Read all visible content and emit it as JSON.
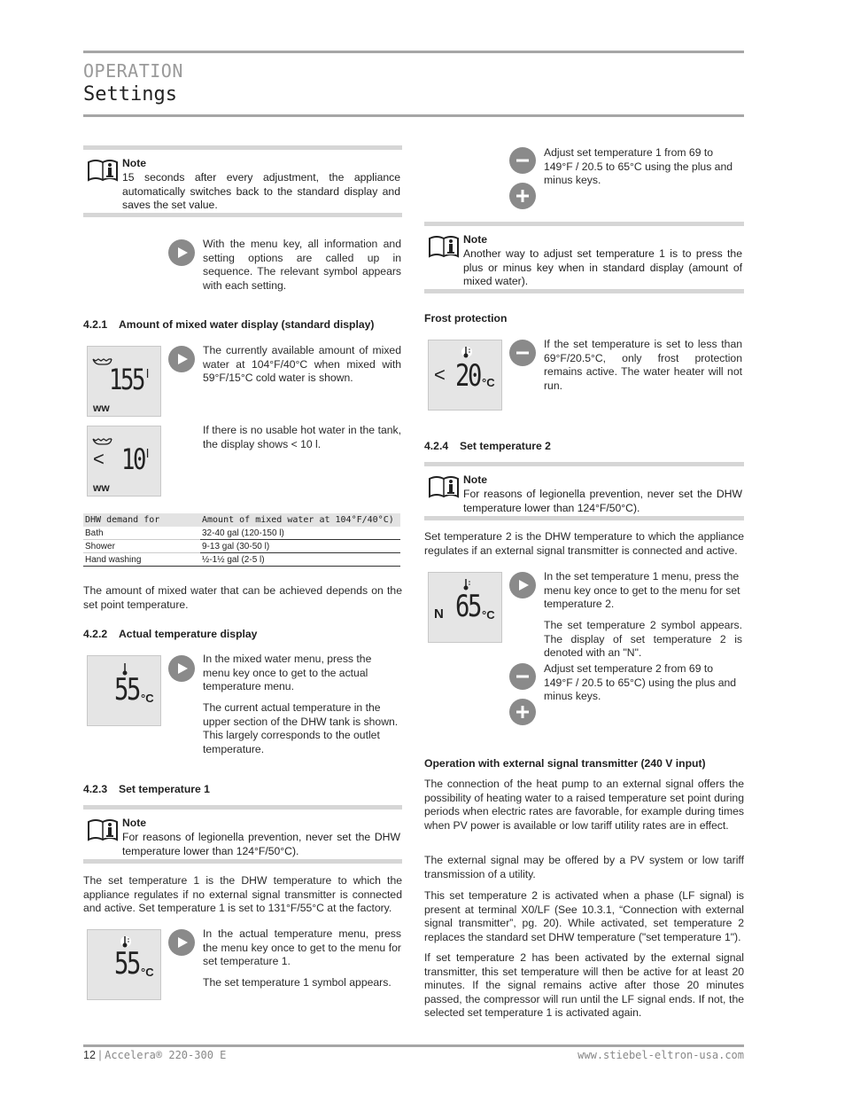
{
  "header": {
    "section": "OPERATION",
    "title": "Settings"
  },
  "left": {
    "note1": {
      "title": "Note",
      "text": "15 seconds after every adjustment, the appliance automatically switches back to the standard display and saves the set value."
    },
    "menu_key_text": "With the menu key, all information and setting options are called up in sequence. The relevant symbol appears with each setting.",
    "s421": {
      "num": "4.2.1",
      "title": "Amount of mixed water display (standard display)"
    },
    "lcd155": {
      "value": "155",
      "unit": "l",
      "label": "ww"
    },
    "text155": "The currently available amount of mixed water at 104°F/40°C when mixed with 59°F/15°C cold water is shown.",
    "lcd10": {
      "prefix": "<",
      "value": "10",
      "unit": "l",
      "label": "ww"
    },
    "text10": "If there is no usable hot water in the tank, the display shows < 10 l.",
    "table": {
      "headers": [
        "DHW demand for",
        "Amount of mixed water at 104°F/40°C)"
      ],
      "rows": [
        [
          "Bath",
          "32-40 gal (120-150 l)"
        ],
        [
          "Shower",
          "9-13 gal (30-50 l)"
        ],
        [
          "Hand washing",
          "½-1½ gal (2-5 l)"
        ]
      ]
    },
    "mixed_note": "The amount of mixed water that can be achieved depends on the set point temperature.",
    "s422": {
      "num": "4.2.2",
      "title": "Actual temperature display"
    },
    "lcd55a": {
      "value": "55",
      "unit": "°C"
    },
    "actual_text1": "In the mixed water menu, press the menu key once to get to the actual temperature menu.",
    "actual_text2": "The current actual temperature in the upper section of the DHW tank is shown. This largely corresponds to the outlet temperature.",
    "s423": {
      "num": "4.2.3",
      "title": "Set temperature 1"
    },
    "note2": {
      "title": "Note",
      "text": "For reasons of legionella prevention, never set the DHW temperature lower than 124°F/50°C)."
    },
    "set1_text": "The set temperature 1 is the DHW temperature to which the appliance regulates if no external signal transmitter is connected and active. Set temperature 1 is set to 131°F/55°C at the factory.",
    "lcd55b": {
      "value": "55",
      "unit": "°C"
    },
    "set1_menu_text": "In the actual temperature menu, press the menu key once to get to the menu for set temperature 1.",
    "set1_symbol_text": "The set temperature 1 symbol appears."
  },
  "right": {
    "adjust1_text": "Adjust set temperature 1 from 69 to 149°F / 20.5 to 65°C using the plus and minus keys.",
    "note3": {
      "title": "Note",
      "text": "Another way to adjust set temperature 1 is to press the plus or minus key when in standard display (amount of mixed water)."
    },
    "frost_heading": "Frost protection",
    "lcd20": {
      "prefix": "<",
      "value": "20",
      "unit": "°C"
    },
    "frost_text": "If the set temperature is set to less than 69°F/20.5°C, only frost protection remains active. The water heater will not run.",
    "s424": {
      "num": "4.2.4",
      "title": "Set temperature 2"
    },
    "note4": {
      "title": "Note",
      "text": "For reasons of legionella prevention, never set the DHW temperature lower than 124°F/50°C)."
    },
    "set2_text": "Set temperature 2 is the DHW temperature to which the appliance regulates if an external signal transmitter is connected and active.",
    "lcd65": {
      "prefix": "N",
      "value": "65",
      "unit": "°C"
    },
    "set2_menu_text": "In the set temperature 1 menu, press the menu key once to get to the menu for set temperature 2.",
    "set2_symbol_text": "The set temperature 2 symbol appears. The display of set temperature 2 is denoted with an \"N\".",
    "adjust2_text": "Adjust set temperature 2 from 69 to 149°F / 20.5 to 65°C) using the plus and minus keys.",
    "ext_heading": "Operation with external signal transmitter (240 V input)",
    "ext_p1": "The connection of the heat pump to an external signal offers the possibility of heating water to a raised temperature set point during periods when electric rates are favorable, for example during times when PV power is available or low tariff utility rates are in effect.",
    "ext_p2": "The external signal may be offered by a PV system or low tariff transmission of a utility.",
    "ext_p3": "This set temperature 2 is activated when a phase (LF signal) is present at terminal X0/LF (See 10.3.1, “Connection with external signal transmitter”, pg. 20). While activated, set temperature 2 replaces the standard set DHW temperature (\"set temperature 1\").",
    "ext_p4": "If set temperature 2 has been activated by the external signal transmitter, this set temperature will then be active for at least 20 minutes. If the signal remains active after those 20 minutes passed, the compressor will run until the LF signal ends. If not, the selected set temperature 1 is activated again."
  },
  "footer": {
    "page": "12",
    "separator": " | ",
    "product": "Accelera® 220-300 E",
    "url": "www.stiebel-eltron-usa.com"
  },
  "colors": {
    "rule": "#a6a6a6",
    "note_bar": "#d6d6d6",
    "key": "#8a8a8a",
    "lcd_bg": "#e5e5e5"
  }
}
